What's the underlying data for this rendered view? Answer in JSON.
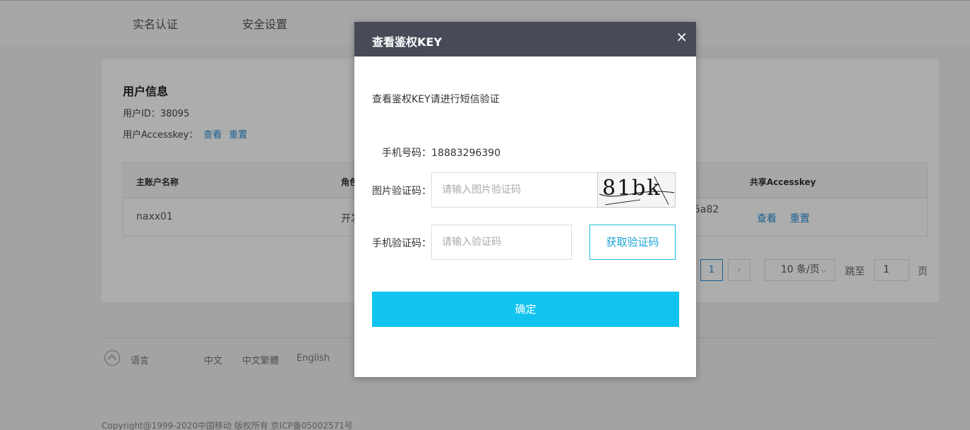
{
  "nav": {
    "tabs": [
      "实名认证",
      "安全设置"
    ]
  },
  "user_info": {
    "title": "用户信息",
    "user_id_label": "用户ID：",
    "user_id": "38095",
    "accesskey_label": "用户Accesskey：",
    "view_label": "查看",
    "reset_label": "重置"
  },
  "table": {
    "headers": [
      "主账户名称",
      "角色",
      "共享Accesskey"
    ],
    "row": {
      "name": "naxx01",
      "role": "开发",
      "key_fragment": "5a82",
      "view_label": "查看",
      "reset_label": "重置"
    }
  },
  "pagination": {
    "current_page": "1",
    "next_label": "›",
    "page_size": "10 条/页",
    "jump_label": "跳至",
    "jump_value": "1",
    "page_suffix": "页"
  },
  "footer": {
    "language_label": "语言",
    "languages": [
      "中文",
      "中文繁體",
      "English"
    ],
    "copyright": "Copyright@1999-2020中国移动 版权所有   京ICP备05002571号"
  },
  "modal": {
    "title": "查看鉴权KEY",
    "close_label": "×",
    "description": "查看鉴权KEY请进行短信验证",
    "phone_label": "手机号码：",
    "phone_number": "18883296390",
    "image_code_label": "图片验证码：",
    "image_code_placeholder": "请输入图片验证码",
    "captcha_text": "81bk",
    "sms_code_label": "手机验证码：",
    "sms_code_placeholder": "请输入验证码",
    "get_code_label": "获取验证码",
    "confirm_label": "确定"
  },
  "colors": {
    "modal_header_bg": "#474b58",
    "confirm_bg": "#10c4ef",
    "link": "#2a8fd6"
  }
}
